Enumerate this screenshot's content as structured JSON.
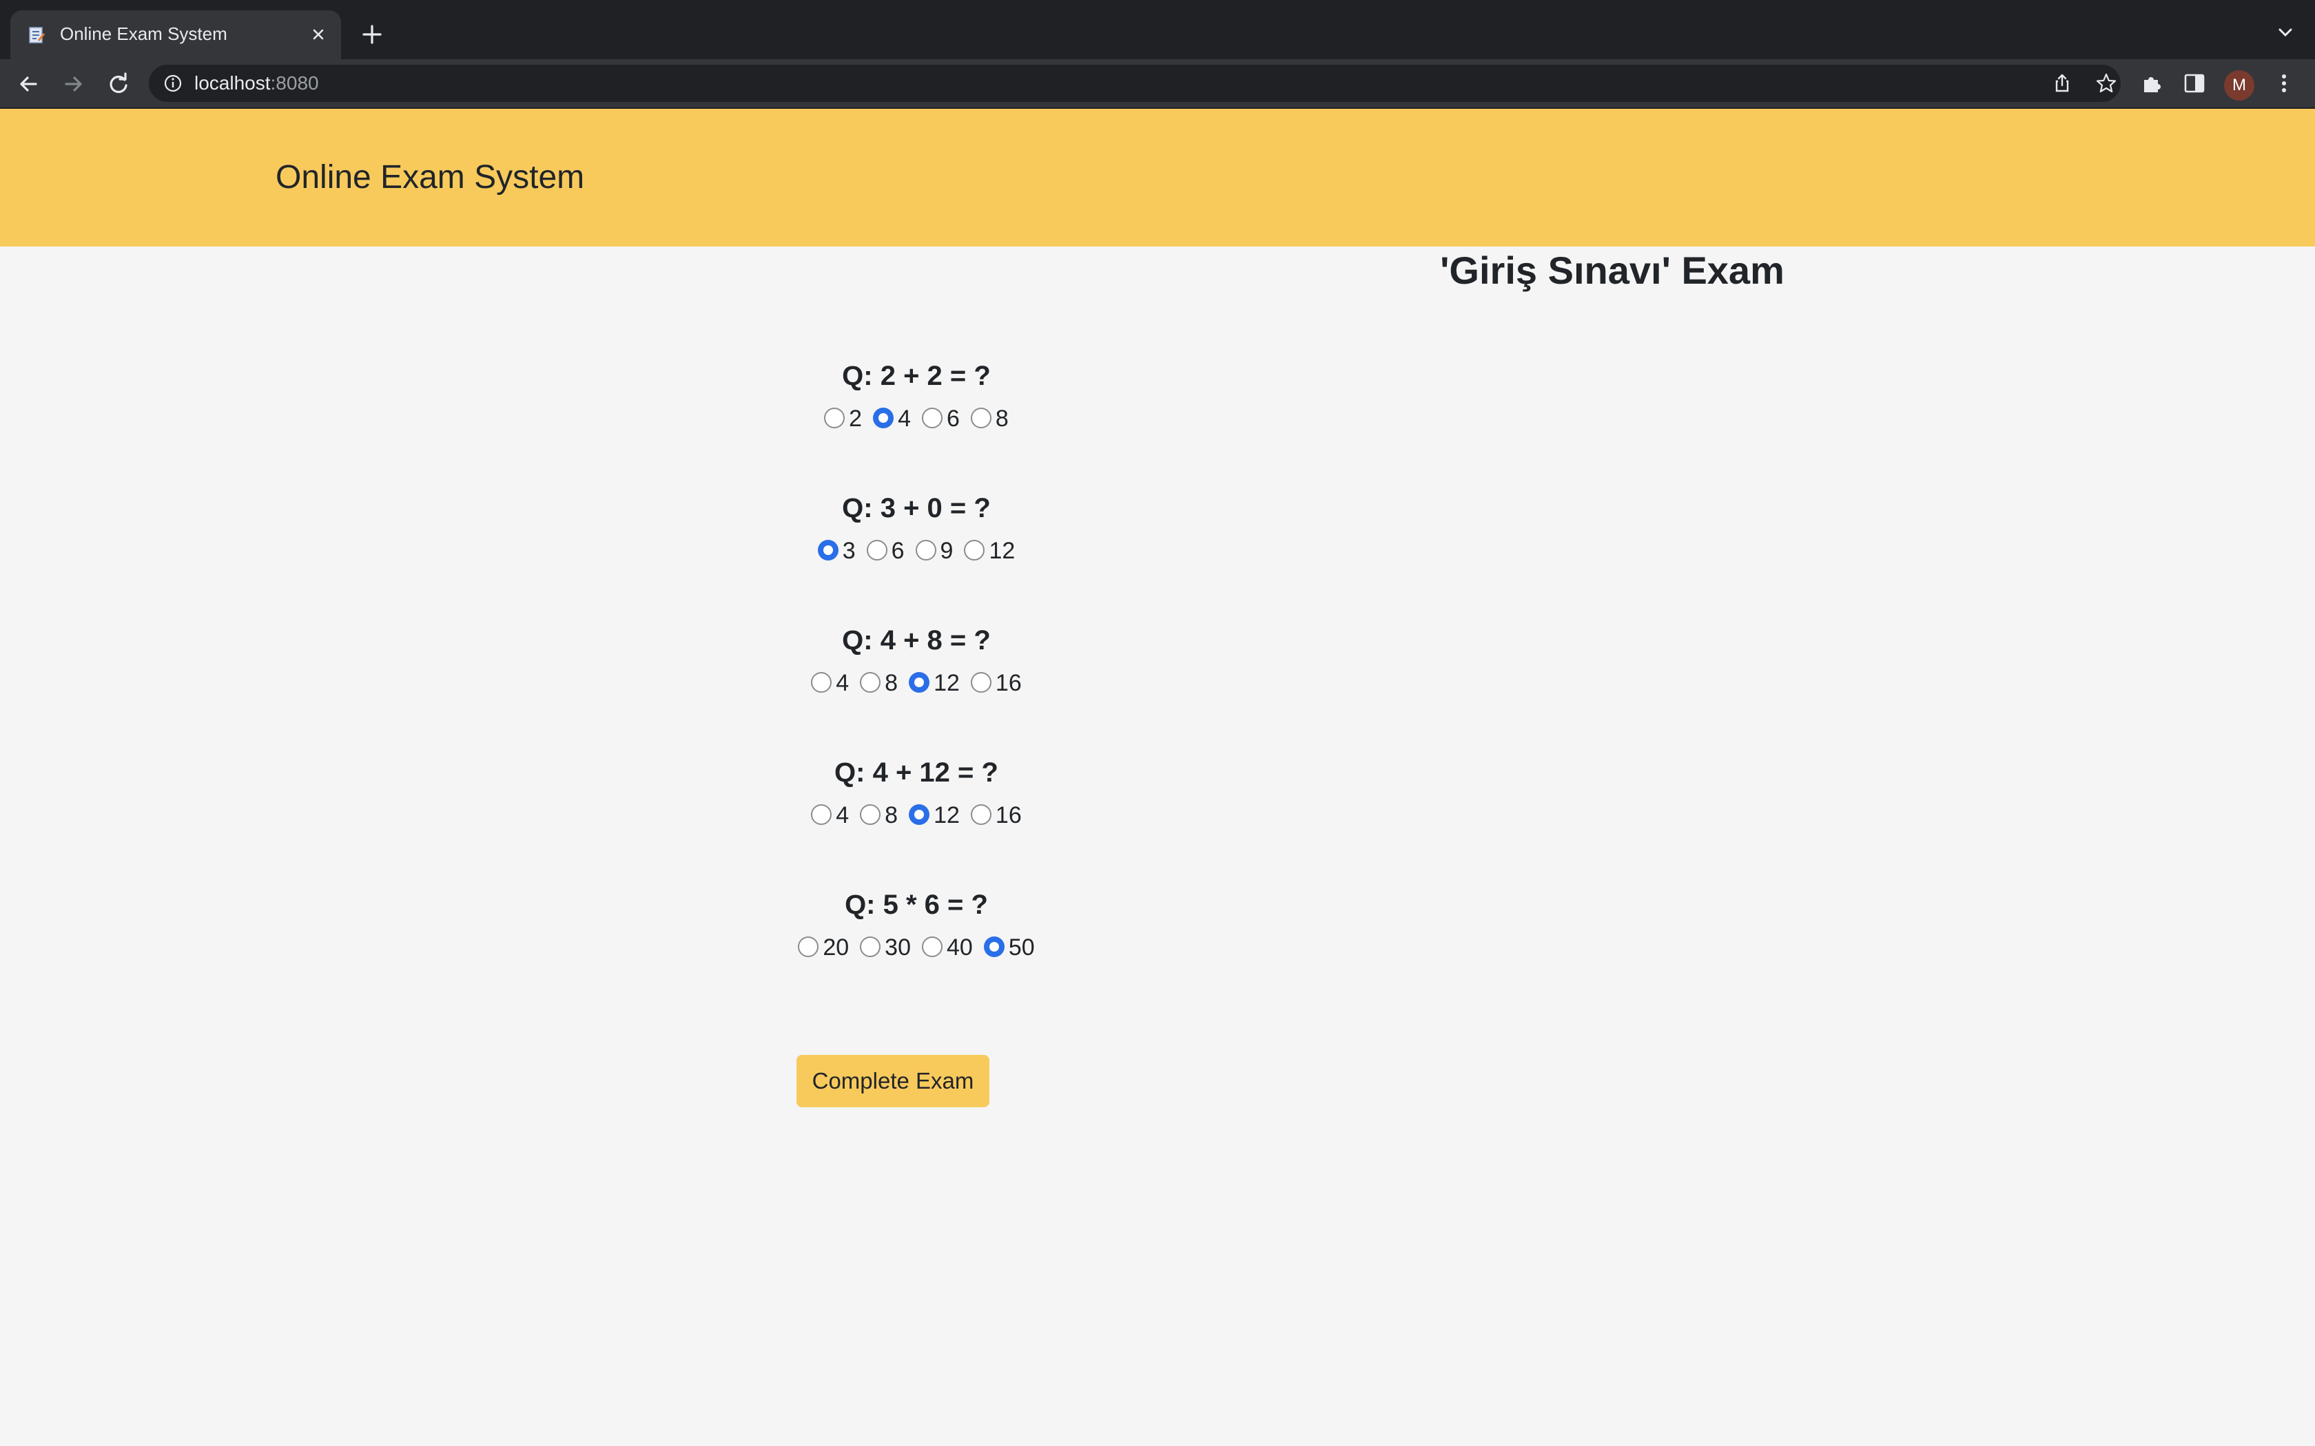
{
  "browser": {
    "tab_title": "Online Exam System",
    "url_host": "localhost",
    "url_port": ":8080",
    "profile_initial": "M"
  },
  "header": {
    "brand": "Online Exam System"
  },
  "exam": {
    "title": "'Giriş Sınavı' Exam",
    "questions": [
      {
        "text": "Q: 2 + 2 = ?",
        "options": [
          "2",
          "4",
          "6",
          "8"
        ],
        "selected": "4"
      },
      {
        "text": "Q: 3 + 0 = ?",
        "options": [
          "3",
          "6",
          "9",
          "12"
        ],
        "selected": "3"
      },
      {
        "text": "Q: 4 + 8 = ?",
        "options": [
          "4",
          "8",
          "12",
          "16"
        ],
        "selected": "12"
      },
      {
        "text": "Q: 4 + 12 = ?",
        "options": [
          "4",
          "8",
          "12",
          "16"
        ],
        "selected": "12"
      },
      {
        "text": "Q: 5 * 6 = ?",
        "options": [
          "20",
          "30",
          "40",
          "50"
        ],
        "selected": "50"
      }
    ],
    "submit_label": "Complete Exam"
  },
  "colors": {
    "accent": "#f8ca5c",
    "radio_checked": "#2a6ee8",
    "page_bg": "#f5f5f5"
  }
}
